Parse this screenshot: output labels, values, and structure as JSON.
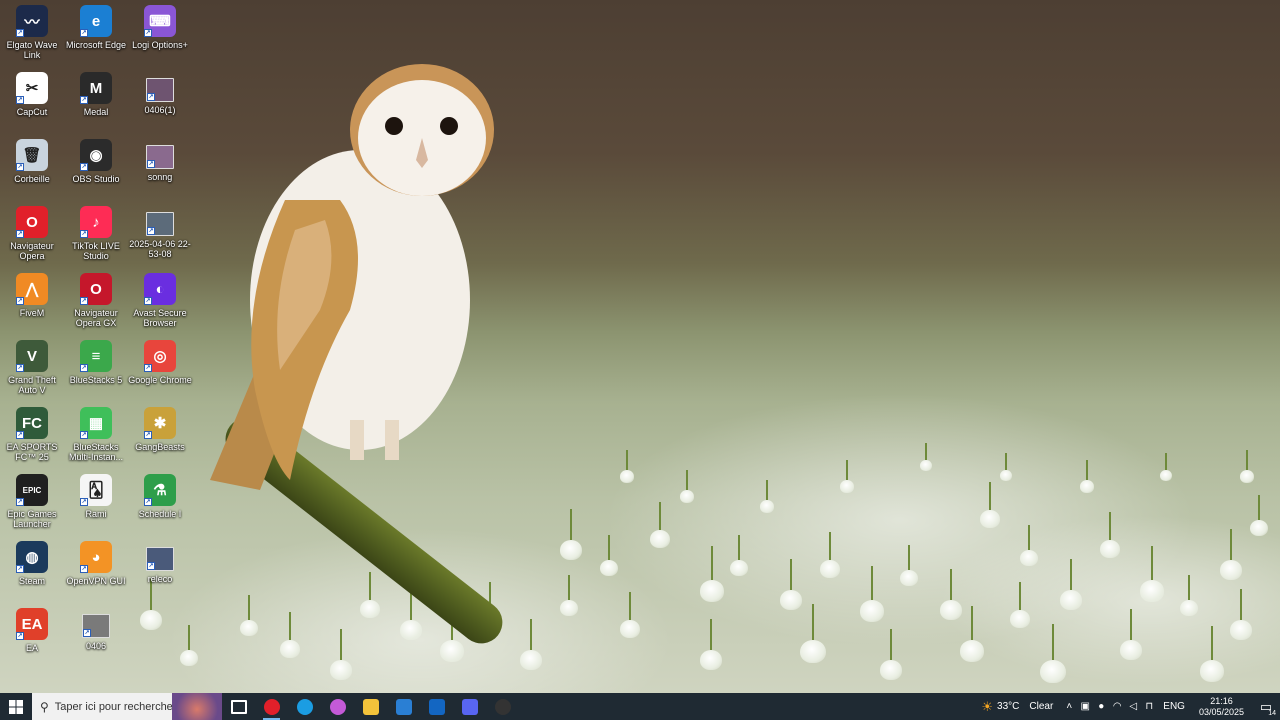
{
  "desktop": {
    "icons": [
      {
        "label": "Elgato Wave Link",
        "icon": "wave-link-icon",
        "color": "#1c2a4a",
        "glyph": "〰"
      },
      {
        "label": "Microsoft Edge",
        "icon": "edge-icon",
        "color": "#1b7fd3",
        "glyph": "e"
      },
      {
        "label": "Logi Options+",
        "icon": "logi-options-icon",
        "color": "#8a56d6",
        "glyph": "⌨"
      },
      {
        "label": "CapCut",
        "icon": "capcut-icon",
        "color": "#ffffff",
        "glyph": "✂"
      },
      {
        "label": "Medal",
        "icon": "medal-icon",
        "color": "#2a2a2a",
        "glyph": "M"
      },
      {
        "label": "0406(1)",
        "icon": "video-file-icon",
        "color": "#6e5470",
        "glyph": ""
      },
      {
        "label": "Corbeille",
        "icon": "recycle-bin-icon",
        "color": "#c9d4de",
        "glyph": "🗑"
      },
      {
        "label": "OBS Studio",
        "icon": "obs-icon",
        "color": "#2b2b2b",
        "glyph": "◉"
      },
      {
        "label": "sonng",
        "icon": "video-file-icon",
        "color": "#8a6a8e",
        "glyph": ""
      },
      {
        "label": "Navigateur Opera",
        "icon": "opera-icon",
        "color": "#e1202a",
        "glyph": "O"
      },
      {
        "label": "TikTok LIVE Studio",
        "icon": "tiktok-live-icon",
        "color": "#fe2c55",
        "glyph": "♪"
      },
      {
        "label": "2025-04-06 22-53-08",
        "icon": "video-file-icon",
        "color": "#5c6b7a",
        "glyph": ""
      },
      {
        "label": "FiveM",
        "icon": "fivem-icon",
        "color": "#f08a24",
        "glyph": "⋀"
      },
      {
        "label": "Navigateur Opera GX",
        "icon": "opera-gx-icon",
        "color": "#c5172b",
        "glyph": "O"
      },
      {
        "label": "Avast Secure Browser",
        "icon": "avast-browser-icon",
        "color": "#6a2ee0",
        "glyph": "◐"
      },
      {
        "label": "Grand Theft Auto V",
        "icon": "gta-icon",
        "color": "#3e5a3a",
        "glyph": "V"
      },
      {
        "label": "BlueStacks 5",
        "icon": "bluestacks-icon",
        "color": "#3ba84b",
        "glyph": "≡"
      },
      {
        "label": "Google Chrome",
        "icon": "chrome-icon",
        "color": "#e8453c",
        "glyph": "◎"
      },
      {
        "label": "EA SPORTS FC™ 25",
        "icon": "ea-fc-icon",
        "color": "#2f5b3a",
        "glyph": "FC"
      },
      {
        "label": "BlueStacks Multi-Instan...",
        "icon": "bluestacks-multi-icon",
        "color": "#3fbf5a",
        "glyph": "▦"
      },
      {
        "label": "GangBeasts",
        "icon": "gang-beasts-icon",
        "color": "#c9a13a",
        "glyph": "✱"
      },
      {
        "label": "Epic Games Launcher",
        "icon": "epic-games-icon",
        "color": "#202020",
        "glyph": "EPIC"
      },
      {
        "label": "Rami",
        "icon": "rami-icon",
        "color": "#f5f5f5",
        "glyph": "🂡"
      },
      {
        "label": "Schedule I",
        "icon": "schedule-i-icon",
        "color": "#2e9e4a",
        "glyph": "⚗"
      },
      {
        "label": "Steam",
        "icon": "steam-icon",
        "color": "#1b3a5c",
        "glyph": "◍"
      },
      {
        "label": "OpenVPN GUI",
        "icon": "openvpn-icon",
        "color": "#f39325",
        "glyph": "◕"
      },
      {
        "label": "releco",
        "icon": "image-file-icon",
        "color": "#4a5a7a",
        "glyph": ""
      },
      {
        "label": "EA",
        "icon": "ea-icon",
        "color": "#e0402a",
        "glyph": "EA"
      },
      {
        "label": "0406",
        "icon": "video-file-icon",
        "color": "#7a7a7a",
        "glyph": ""
      }
    ]
  },
  "taskbar": {
    "search_placeholder": "Taper ici pour rechercher",
    "pinned": [
      {
        "name": "task-view-icon",
        "color": "#ffffff"
      },
      {
        "name": "opera-icon",
        "color": "#e1202a"
      },
      {
        "name": "edge-icon",
        "color": "#1b9de2"
      },
      {
        "name": "copilot-icon",
        "color": "#c45ad8"
      },
      {
        "name": "file-explorer-icon",
        "color": "#f3c33b"
      },
      {
        "name": "microsoft-store-icon",
        "color": "#2a7fd4"
      },
      {
        "name": "outlook-icon",
        "color": "#1366c2"
      },
      {
        "name": "discord-icon",
        "color": "#5865f2"
      },
      {
        "name": "obs-icon",
        "color": "#333333"
      }
    ],
    "weather": {
      "temp": "33°C",
      "condition": "Clear"
    },
    "language": "ENG",
    "time": "21:16",
    "date": "03/05/2025",
    "notification_count": "14"
  }
}
